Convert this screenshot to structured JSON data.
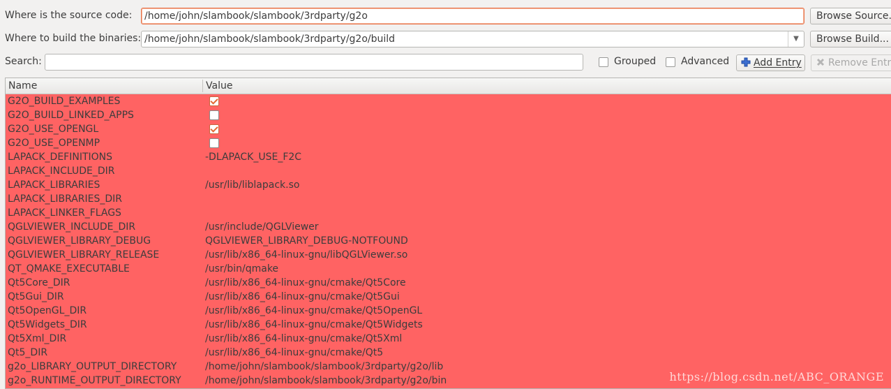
{
  "source": {
    "label": "Where is the source code:",
    "value": "/home/john/slambook/slambook/3rdparty/g2o",
    "button": "Browse Source..."
  },
  "build": {
    "label": "Where to build the binaries:",
    "value": "/home/john/slambook/slambook/3rdparty/g2o/build",
    "button": "Browse Build..."
  },
  "search": {
    "label": "Search:",
    "value": ""
  },
  "options": {
    "grouped": "Grouped",
    "advanced": "Advanced",
    "add_entry": "Add Entry",
    "remove_entry": "Remove Entry"
  },
  "table": {
    "headers": [
      "Name",
      "Value"
    ],
    "highlight_color": "#ff6363",
    "rows": [
      {
        "name": "G2O_BUILD_EXAMPLES",
        "type": "bool",
        "checked": true,
        "value": ""
      },
      {
        "name": "G2O_BUILD_LINKED_APPS",
        "type": "bool",
        "checked": false,
        "value": ""
      },
      {
        "name": "G2O_USE_OPENGL",
        "type": "bool",
        "checked": true,
        "value": ""
      },
      {
        "name": "G2O_USE_OPENMP",
        "type": "bool",
        "checked": false,
        "value": ""
      },
      {
        "name": "LAPACK_DEFINITIONS",
        "type": "text",
        "value": "-DLAPACK_USE_F2C"
      },
      {
        "name": "LAPACK_INCLUDE_DIR",
        "type": "text",
        "value": ""
      },
      {
        "name": "LAPACK_LIBRARIES",
        "type": "text",
        "value": "/usr/lib/liblapack.so"
      },
      {
        "name": "LAPACK_LIBRARIES_DIR",
        "type": "text",
        "value": ""
      },
      {
        "name": "LAPACK_LINKER_FLAGS",
        "type": "text",
        "value": ""
      },
      {
        "name": "QGLVIEWER_INCLUDE_DIR",
        "type": "text",
        "value": "/usr/include/QGLViewer"
      },
      {
        "name": "QGLVIEWER_LIBRARY_DEBUG",
        "type": "text",
        "value": "QGLVIEWER_LIBRARY_DEBUG-NOTFOUND"
      },
      {
        "name": "QGLVIEWER_LIBRARY_RELEASE",
        "type": "text",
        "value": "/usr/lib/x86_64-linux-gnu/libQGLViewer.so"
      },
      {
        "name": "QT_QMAKE_EXECUTABLE",
        "type": "text",
        "value": "/usr/bin/qmake"
      },
      {
        "name": "Qt5Core_DIR",
        "type": "text",
        "value": "/usr/lib/x86_64-linux-gnu/cmake/Qt5Core"
      },
      {
        "name": "Qt5Gui_DIR",
        "type": "text",
        "value": "/usr/lib/x86_64-linux-gnu/cmake/Qt5Gui"
      },
      {
        "name": "Qt5OpenGL_DIR",
        "type": "text",
        "value": "/usr/lib/x86_64-linux-gnu/cmake/Qt5OpenGL"
      },
      {
        "name": "Qt5Widgets_DIR",
        "type": "text",
        "value": "/usr/lib/x86_64-linux-gnu/cmake/Qt5Widgets"
      },
      {
        "name": "Qt5Xml_DIR",
        "type": "text",
        "value": "/usr/lib/x86_64-linux-gnu/cmake/Qt5Xml"
      },
      {
        "name": "Qt5_DIR",
        "type": "text",
        "value": "/usr/lib/x86_64-linux-gnu/cmake/Qt5"
      },
      {
        "name": "g2o_LIBRARY_OUTPUT_DIRECTORY",
        "type": "text",
        "value": "/home/john/slambook/slambook/3rdparty/g2o/lib"
      },
      {
        "name": "g2o_RUNTIME_OUTPUT_DIRECTORY",
        "type": "text",
        "value": "/home/john/slambook/slambook/3rdparty/g2o/bin"
      }
    ]
  },
  "watermark": "https://blog.csdn.net/ABC_ORANGE"
}
